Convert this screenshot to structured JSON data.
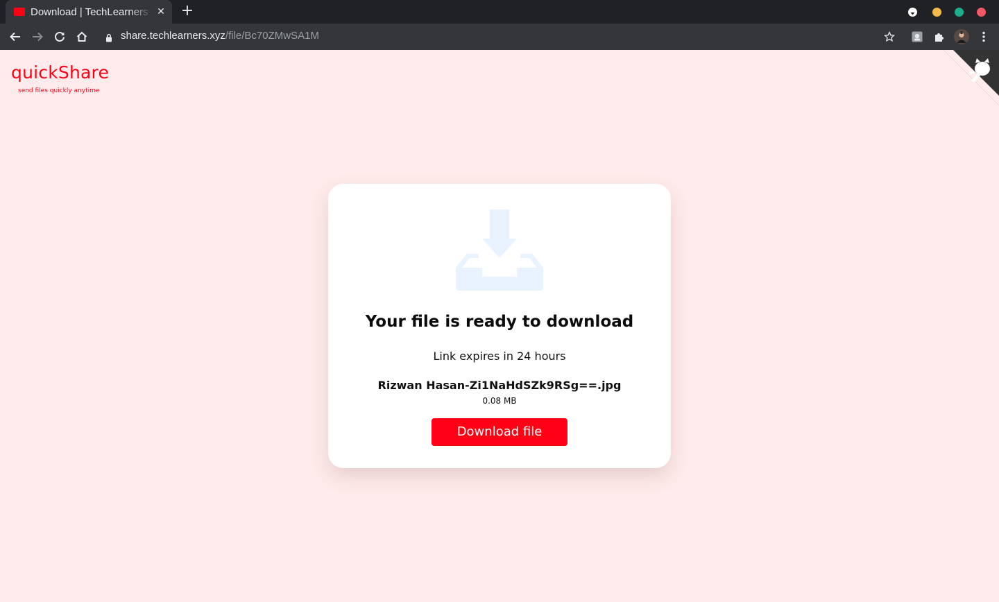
{
  "browser": {
    "tab": {
      "title": "Download | TechLearners",
      "favicon": "youtube-style-favicon",
      "close_label": "✕"
    },
    "new_tab_label": "+",
    "url": {
      "host": "share.techlearners.xyz",
      "path": "/file/Bc70ZMwSA1M"
    },
    "window_controls": {
      "menu": "#ffffff",
      "minimize": "#f5b94a",
      "maximize": "#1bae8c",
      "close": "#f25866"
    }
  },
  "page": {
    "logo": "quickShare",
    "tagline": "send files quickly anytime",
    "card": {
      "icon": "download-tray-icon",
      "title": "Your file is ready to download",
      "expiry": "Link expires in 24 hours",
      "file_name": "Rizwan Hasan-Zi1NaHdSZk9RSg==.jpg",
      "file_size": "0.08 MB",
      "download_label": "Download file"
    }
  },
  "colors": {
    "accent": "#ff0014",
    "page_background": "#ffebeb",
    "icon_tint": "#e8f3ff",
    "corner": "#333333"
  }
}
